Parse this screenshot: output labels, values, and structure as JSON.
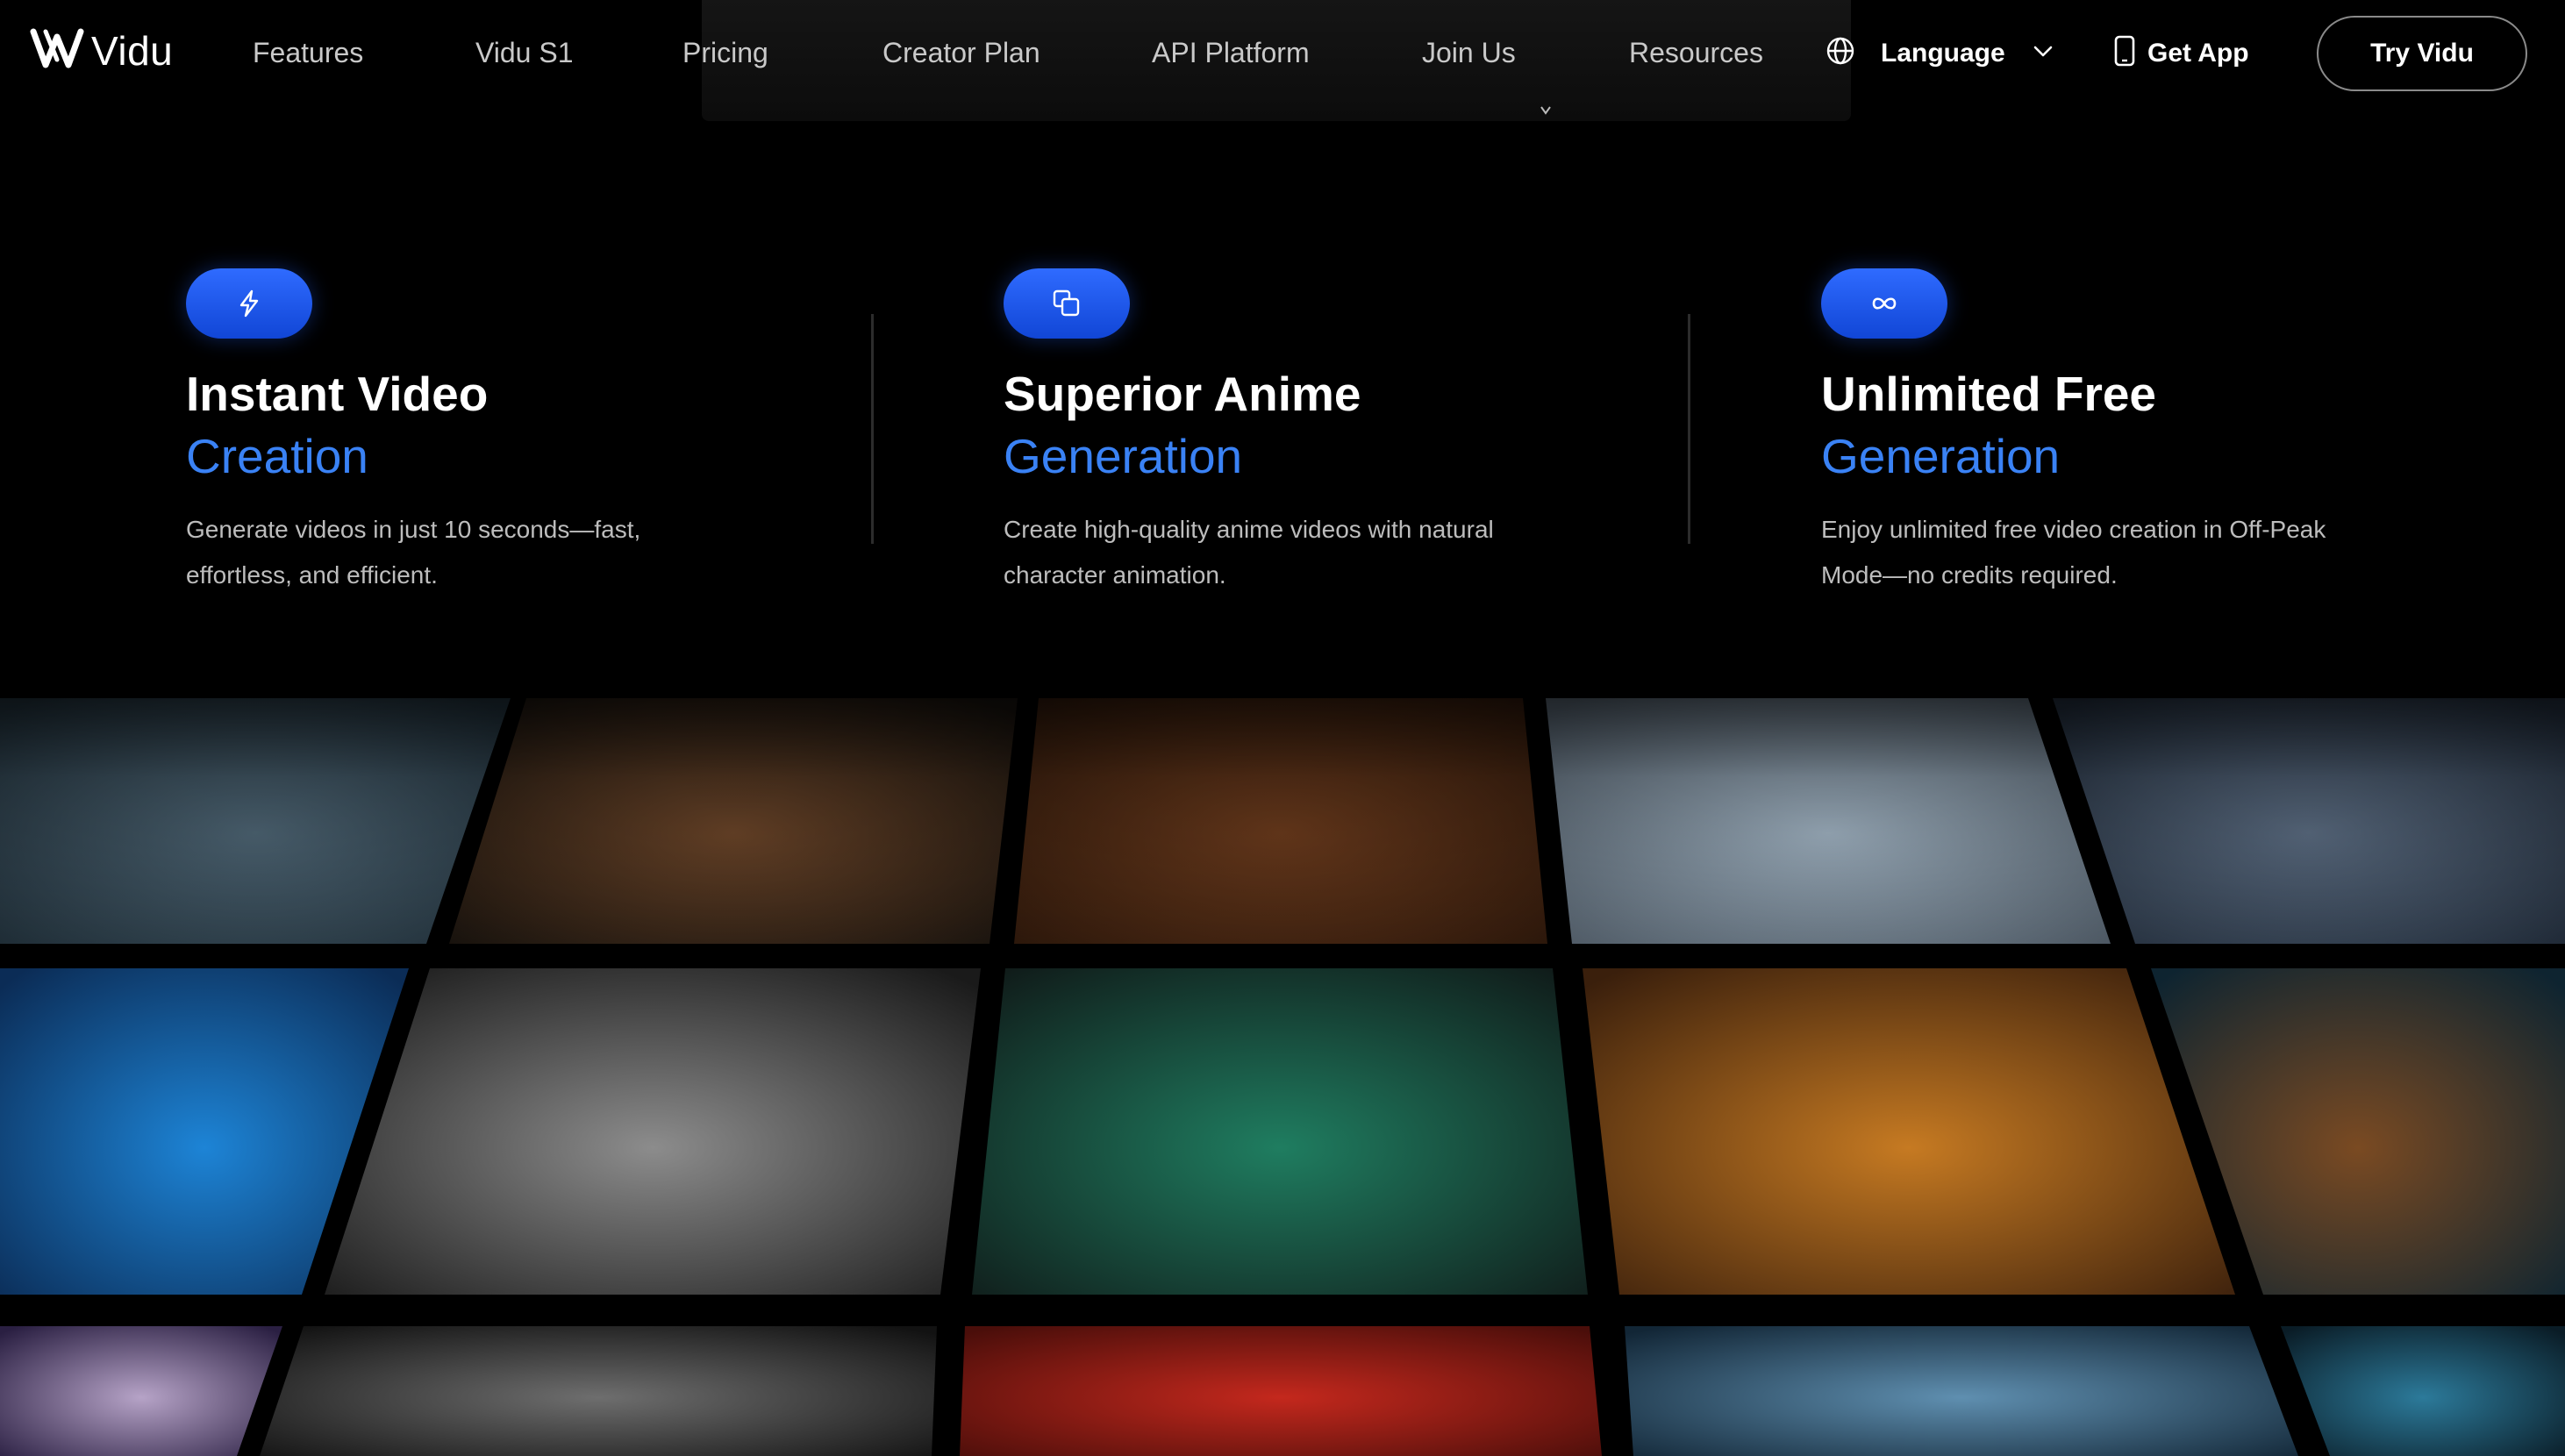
{
  "nav": {
    "logo_text": "Vidu",
    "links": [
      "Features",
      "Vidu S1",
      "Pricing",
      "Creator Plan",
      "API Platform",
      "Join Us",
      "Resources"
    ],
    "language_label": "Language",
    "get_app_label": "Get App",
    "try_label": "Try Vidu"
  },
  "features": [
    {
      "icon": "lightning-icon",
      "title": "Instant Video",
      "subtitle": "Creation",
      "description": "Generate videos in just 10 seconds—fast, effortless, and efficient."
    },
    {
      "icon": "copy-icon",
      "title": "Superior Anime",
      "subtitle": "Generation",
      "description": "Create high-quality anime videos with natural character animation."
    },
    {
      "icon": "infinity-icon",
      "title": "Unlimited Free",
      "subtitle": "Generation",
      "description": "Enjoy unlimited free video creation in Off-Peak Mode—no credits required."
    }
  ],
  "colors": {
    "accent": "#3a82f5",
    "icon_bg": "#1f5cf0",
    "background": "#000000",
    "nav_text": "#c9c9c9"
  },
  "gallery": [
    {
      "name": "underwater-hand",
      "c1": "#4d6473",
      "c2": "#1d2b34"
    },
    {
      "name": "portrait-bubble",
      "c1": "#6a4428",
      "c2": "#14100c"
    },
    {
      "name": "kitten",
      "c1": "#6a3a1c",
      "c2": "#2a160a"
    },
    {
      "name": "dragon-apple",
      "c1": "#9eb0bf",
      "c2": "#4a5560"
    },
    {
      "name": "fantasy-girl",
      "c1": "#5a6b80",
      "c2": "#1e2835"
    },
    {
      "name": "teddy-bear",
      "c1": "#1d84d6",
      "c2": "#0b2c56"
    },
    {
      "name": "silver-statue",
      "c1": "#8c8c8c",
      "c2": "#1a1a1a"
    },
    {
      "name": "demon-green",
      "c1": "#1f7d60",
      "c2": "#101c1a"
    },
    {
      "name": "car-fire",
      "c1": "#c67a22",
      "c2": "#3a1f0c"
    },
    {
      "name": "octopus",
      "c1": "#7a4a22",
      "c2": "#0e2430"
    },
    {
      "name": "night-sky",
      "c1": "#b6a3c7",
      "c2": "#2a1f42"
    },
    {
      "name": "dark-water",
      "c1": "#6e6e6e",
      "c2": "#121212"
    },
    {
      "name": "theater-girl",
      "c1": "#c4281d",
      "c2": "#4a0e0a"
    },
    {
      "name": "storm-wave",
      "c1": "#5f8fb0",
      "c2": "#122636"
    },
    {
      "name": "bird-eye",
      "c1": "#2c7a9a",
      "c2": "#0a1c26"
    }
  ]
}
